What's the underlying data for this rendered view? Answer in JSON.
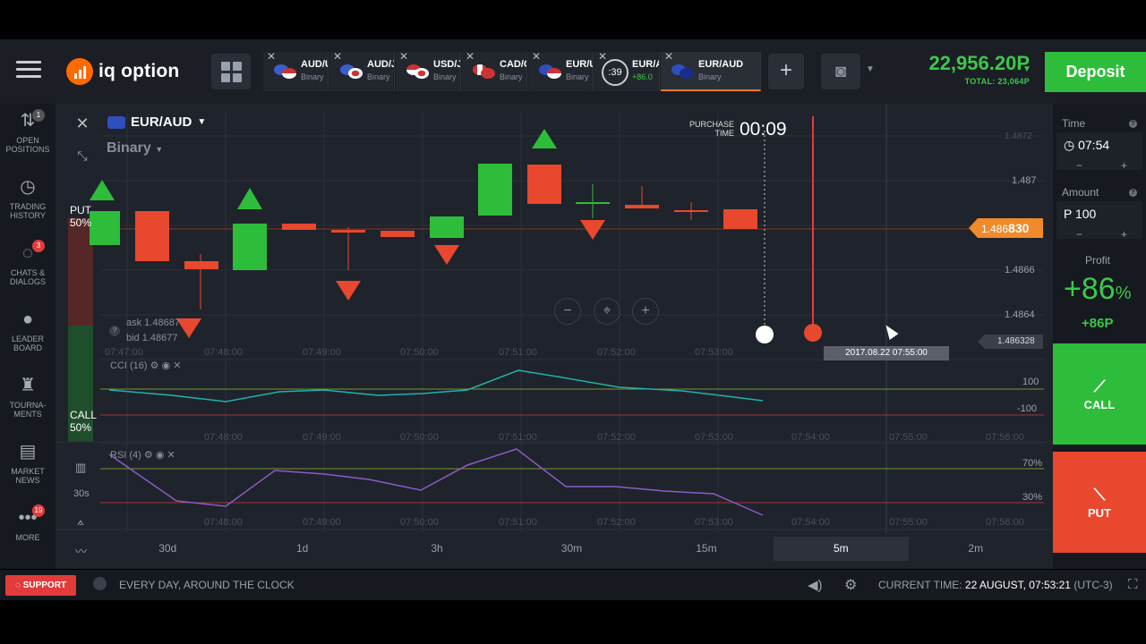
{
  "app": {
    "logo_text": "iq option",
    "balance": "22,956.20P",
    "balance_total": "TOTAL: 23,064P",
    "deposit_label": "Deposit"
  },
  "tabs": [
    {
      "pair": "AUD/U",
      "type": "Binary"
    },
    {
      "pair": "AUD/J",
      "type": "Binary"
    },
    {
      "pair": "USD/J",
      "type": "Binary"
    },
    {
      "pair": "CAD/C",
      "type": "Binary"
    },
    {
      "pair": "EUR/U",
      "type": "Binary"
    },
    {
      "pair": "EUR/A",
      "type": "+86.0",
      "timer": ":39"
    },
    {
      "pair": "EUR/AUD",
      "type": "Binary",
      "active": true
    }
  ],
  "sidebar": {
    "items": [
      {
        "label": "OPEN POSITIONS",
        "badge": "1",
        "icon": "open-positions-icon"
      },
      {
        "label": "TRADING HISTORY",
        "icon": "history-icon"
      },
      {
        "label": "CHATS & DIALOGS",
        "badge": "3",
        "icon": "chat-icon"
      },
      {
        "label": "LEADER BOARD",
        "icon": "leaderboard-icon"
      },
      {
        "label": "TOURNA-MENTS",
        "icon": "trophy-icon"
      },
      {
        "label": "MARKET NEWS",
        "icon": "news-icon"
      },
      {
        "label": "MORE",
        "badge": "19",
        "icon": "more-icon"
      }
    ]
  },
  "chart": {
    "asset": "EUR/AUD",
    "option_type": "Binary",
    "purchase_label": "PURCHASE TIME",
    "purchase_timer": "00:09",
    "put_label": "PUT",
    "put_pct": "50%",
    "call_label": "CALL",
    "call_pct": "50%",
    "ask": "ask 1.48687",
    "bid": "bid 1.48677",
    "current_price_prefix": "1.486",
    "current_price_suffix": "830",
    "line_price": "1.486328",
    "time_tag": "2017.08.22 07:55:00",
    "price_ticks": [
      "1.4872",
      "1.487",
      "1.4866",
      "1.4864"
    ],
    "time_ticks": [
      "07:47:00",
      "07:48:00",
      "07:49:00",
      "07:50:00",
      "07:51:00",
      "07:52:00",
      "07:53:00",
      "07:54:00",
      "07:55:00",
      "07:56:00"
    ],
    "cci_label": "CCI (16)",
    "cci_levels": [
      "100",
      "-100"
    ],
    "rsi_label": "RSI (4)",
    "rsi_levels": [
      "70%",
      "30%"
    ],
    "side_interval": "30s",
    "periods": [
      "30d",
      "1d",
      "3h",
      "30m",
      "15m",
      "5m",
      "2m"
    ],
    "active_period": "5m"
  },
  "right_panel": {
    "time_label": "Time",
    "time_value": "07:54",
    "amount_label": "Amount",
    "amount_value": "P  100",
    "profit_label": "Profit",
    "profit_pct": "+86",
    "profit_pct_sign": "%",
    "profit_value": "+86P",
    "call_label": "CALL",
    "put_label": "PUT"
  },
  "footer": {
    "support_label": "SUPPORT",
    "tagline": "EVERY DAY, AROUND THE CLOCK",
    "current_time_label": "CURRENT TIME:",
    "current_time_value": "22 AUGUST, 07:53:21",
    "timezone": "(UTC-3)"
  },
  "colors": {
    "up": "#2dbd3a",
    "down": "#e8482e",
    "accent": "#f08a2a",
    "cci": "#20b2aa",
    "rsi": "#8a5cc8"
  }
}
